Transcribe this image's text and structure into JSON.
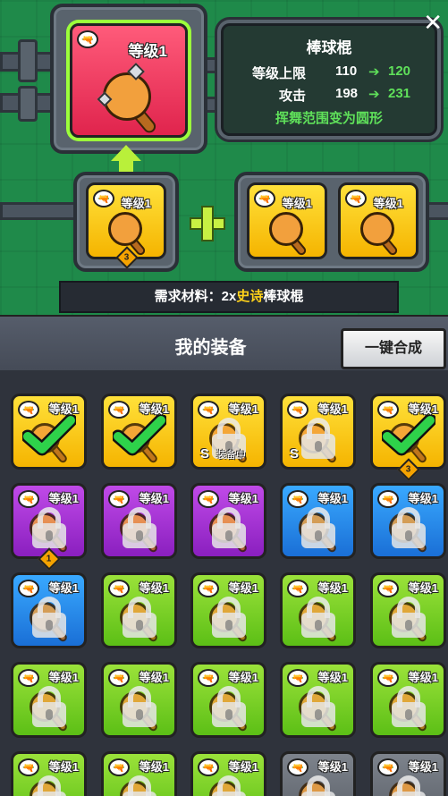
{
  "close_icon": "✕",
  "main_item": {
    "level": "等级1",
    "rarity": "red",
    "icon": "baseball-bat"
  },
  "info": {
    "name": "棒球棍",
    "rows": [
      {
        "label": "等级上限",
        "from": "110",
        "arrow": "➔",
        "to": "120"
      },
      {
        "label": "攻击",
        "from": "198",
        "arrow": "➔",
        "to": "231"
      }
    ],
    "note": "挥舞范围变为圆形"
  },
  "materials": [
    {
      "level": "等级1",
      "rarity": "gold",
      "badge": "3"
    },
    {
      "level": "等级1",
      "rarity": "gold"
    },
    {
      "level": "等级1",
      "rarity": "gold"
    }
  ],
  "requirement": {
    "prefix": "需求材料：2x",
    "highlight": "史诗",
    "suffix": "棒球棍"
  },
  "inventory": {
    "title": "我的装备",
    "merge_all": "一键合成",
    "items": [
      {
        "level": "等级1",
        "rarity": "gold",
        "state": "checked"
      },
      {
        "level": "等级1",
        "rarity": "gold",
        "state": "checked"
      },
      {
        "level": "等级1",
        "rarity": "gold",
        "state": "locked",
        "tag": "S",
        "sub": "装备中"
      },
      {
        "level": "等级1",
        "rarity": "gold",
        "state": "locked",
        "tag": "S"
      },
      {
        "level": "等级1",
        "rarity": "gold",
        "state": "checked",
        "badge": "3"
      },
      {
        "level": "等级1",
        "rarity": "purple",
        "state": "locked",
        "badge": "1"
      },
      {
        "level": "等级1",
        "rarity": "purple",
        "state": "locked"
      },
      {
        "level": "等级1",
        "rarity": "purple",
        "state": "locked"
      },
      {
        "level": "等级1",
        "rarity": "blue",
        "state": "locked"
      },
      {
        "level": "等级1",
        "rarity": "blue",
        "state": "locked"
      },
      {
        "level": "等级1",
        "rarity": "blue",
        "state": "locked"
      },
      {
        "level": "等级1",
        "rarity": "green",
        "state": "locked"
      },
      {
        "level": "等级1",
        "rarity": "green",
        "state": "locked"
      },
      {
        "level": "等级1",
        "rarity": "green",
        "state": "locked"
      },
      {
        "level": "等级1",
        "rarity": "green",
        "state": "locked"
      },
      {
        "level": "等级1",
        "rarity": "green",
        "state": "locked"
      },
      {
        "level": "等级1",
        "rarity": "green",
        "state": "locked"
      },
      {
        "level": "等级1",
        "rarity": "green",
        "state": "locked"
      },
      {
        "level": "等级1",
        "rarity": "green",
        "state": "locked"
      },
      {
        "level": "等级1",
        "rarity": "green",
        "state": "locked"
      },
      {
        "level": "等级1",
        "rarity": "green",
        "state": "locked"
      },
      {
        "level": "等级1",
        "rarity": "green",
        "state": "locked"
      },
      {
        "level": "等级1",
        "rarity": "green",
        "state": "locked"
      },
      {
        "level": "等级1",
        "rarity": "gray",
        "state": "locked"
      },
      {
        "level": "等级1",
        "rarity": "gray",
        "state": "locked"
      }
    ]
  }
}
